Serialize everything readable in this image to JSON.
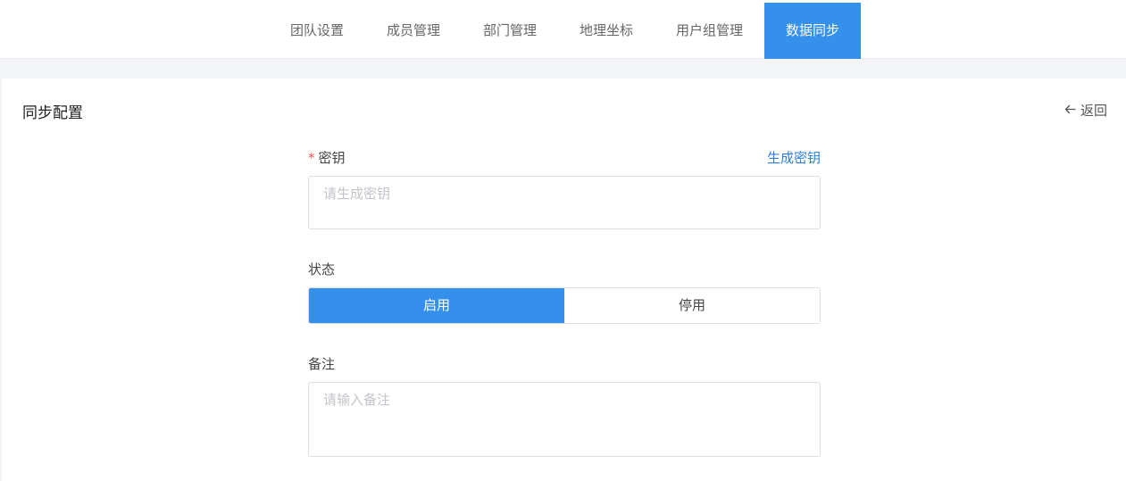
{
  "tabs": [
    {
      "label": "团队设置"
    },
    {
      "label": "成员管理"
    },
    {
      "label": "部门管理"
    },
    {
      "label": "地理坐标"
    },
    {
      "label": "用户组管理"
    },
    {
      "label": "数据同步",
      "active": true
    }
  ],
  "panel": {
    "title": "同步配置",
    "back_label": "返回"
  },
  "form": {
    "secret": {
      "required_mark": "*",
      "label": "密钥",
      "action_label": "生成密钥",
      "placeholder": "请生成密钥",
      "value": ""
    },
    "status": {
      "label": "状态",
      "options": [
        "启用",
        "停用"
      ],
      "selected": "启用"
    },
    "remark": {
      "label": "备注",
      "placeholder": "请输入备注",
      "value": ""
    }
  },
  "colors": {
    "accent": "#3490ea",
    "link": "#2f7fd6",
    "required": "#f15454"
  }
}
